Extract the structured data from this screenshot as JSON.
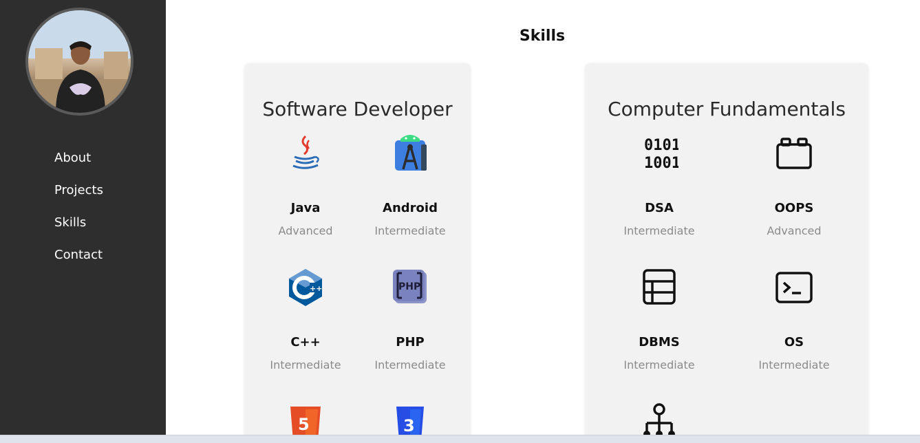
{
  "sidebar": {
    "nav": [
      "About",
      "Projects",
      "Skills",
      "Contact"
    ]
  },
  "main": {
    "title": "Skills",
    "cards": [
      {
        "title": "Software Developer",
        "skills": [
          {
            "name": "Java",
            "level": "Advanced",
            "icon": "java-icon"
          },
          {
            "name": "Android",
            "level": "Intermediate",
            "icon": "android-studio-icon"
          },
          {
            "name": "C++",
            "level": "Intermediate",
            "icon": "cpp-icon"
          },
          {
            "name": "PHP",
            "level": "Intermediate",
            "icon": "php-icon"
          },
          {
            "name": "",
            "level": "",
            "icon": "html5-icon"
          },
          {
            "name": "",
            "level": "",
            "icon": "css3-icon"
          }
        ]
      },
      {
        "title": "Computer Fundamentals",
        "skills": [
          {
            "name": "DSA",
            "level": "Intermediate",
            "icon": "binary-icon"
          },
          {
            "name": "OOPS",
            "level": "Advanced",
            "icon": "box-icon"
          },
          {
            "name": "DBMS",
            "level": "Intermediate",
            "icon": "table-icon"
          },
          {
            "name": "OS",
            "level": "Intermediate",
            "icon": "terminal-icon"
          },
          {
            "name": "",
            "level": "",
            "icon": "network-icon"
          }
        ]
      }
    ]
  },
  "colors": {
    "sidebar_bg": "#2e2e2e",
    "card_bg": "#f2f2f2",
    "level_text": "#8a8a8a"
  }
}
